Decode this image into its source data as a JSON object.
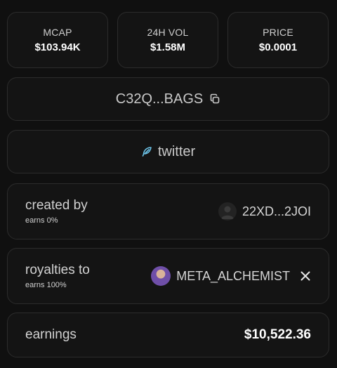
{
  "stats": [
    {
      "label": "MCAP",
      "value": "$103.94K"
    },
    {
      "label": "24H VOL",
      "value": "$1.58M"
    },
    {
      "label": "PRICE",
      "value": "$0.0001"
    }
  ],
  "contract": {
    "address": "C32Q...BAGS",
    "icon": "copy-icon"
  },
  "social": {
    "label": "twitter",
    "icon": "feather-icon",
    "icon_color": "#6cc3e8"
  },
  "creator": {
    "title": "created by",
    "sub": "earns 0%",
    "name": "22XD...2JOI",
    "avatar": "user-silhouette"
  },
  "royalties": {
    "title": "royalties to",
    "sub": "earns 100%",
    "name": "META_ALCHEMIST",
    "avatar_color": "#6f4fa8",
    "icon": "x-logo-icon"
  },
  "earnings": {
    "title": "earnings",
    "value": "$10,522.36"
  }
}
